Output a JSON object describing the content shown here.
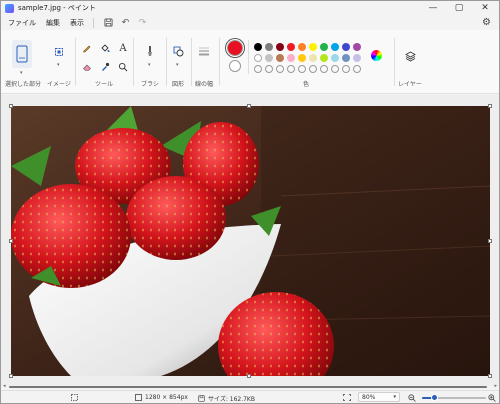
{
  "window": {
    "title": "sample7.jpg - ペイント",
    "controls": {
      "minimize": "—",
      "maximize": "▢",
      "close": "✕"
    }
  },
  "menu": {
    "items": [
      "ファイル",
      "編集",
      "表示"
    ],
    "quick_actions": [
      "save-icon",
      "undo-icon",
      "redo-icon"
    ],
    "settings_icon": "gear-icon"
  },
  "ribbon": {
    "groups": {
      "selection": "選択した部分",
      "image": "イメージ",
      "tools": "ツール",
      "brushes": "ブラシ",
      "shapes": "図形",
      "size": "線の幅",
      "colors": "色",
      "layers": "レイヤー"
    },
    "tools_text_icon": "A",
    "current_colors": {
      "primary": "#e81123",
      "secondary": "#ffffff"
    },
    "palette": [
      [
        "#000000",
        "#7f7f7f",
        "#880015",
        "#ed1c24",
        "#ff7f27",
        "#fff200",
        "#22b14c",
        "#00a2e8",
        "#3f48cc",
        "#a349a4"
      ],
      [
        "#ffffff",
        "#c3c3c3",
        "#b97a57",
        "#ffaec9",
        "#ffc90e",
        "#efe4b0",
        "#b5e61d",
        "#99d9ea",
        "#7092be",
        "#c8bfe7"
      ],
      [
        "",
        "",
        "",
        "",
        "",
        "",
        "",
        "",
        "",
        ""
      ]
    ]
  },
  "status": {
    "image_size": "1280 × 854px",
    "file_size": "サイズ: 162.7KB",
    "zoom": "80%",
    "zoom_level": 0.2
  }
}
